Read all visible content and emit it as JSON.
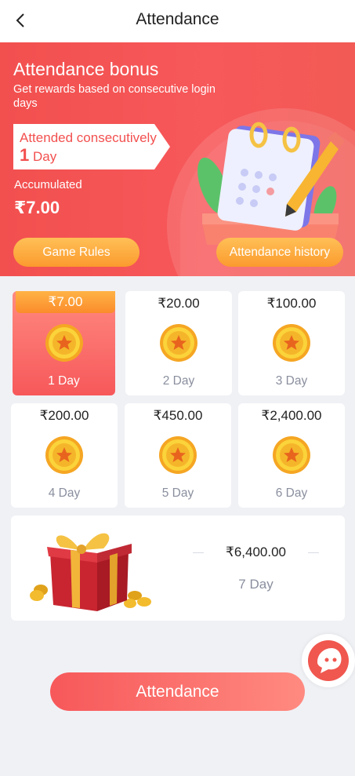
{
  "header": {
    "title": "Attendance"
  },
  "banner": {
    "title": "Attendance bonus",
    "subtitle": "Get rewards based on consecutive login days",
    "tag_prefix": "Attended consecutively",
    "tag_count": "1",
    "tag_suffix": "Day",
    "accumulated_label": "Accumulated",
    "accumulated_value": "₹7.00",
    "rules_button": "Game Rules",
    "history_button": "Attendance history"
  },
  "days": [
    {
      "amount": "₹7.00",
      "label": "1 Day",
      "active": true
    },
    {
      "amount": "₹20.00",
      "label": "2 Day",
      "active": false
    },
    {
      "amount": "₹100.00",
      "label": "3 Day",
      "active": false
    },
    {
      "amount": "₹200.00",
      "label": "4 Day",
      "active": false
    },
    {
      "amount": "₹450.00",
      "label": "5 Day",
      "active": false
    },
    {
      "amount": "₹2,400.00",
      "label": "6 Day",
      "active": false
    }
  ],
  "final_day": {
    "amount": "₹6,400.00",
    "label": "7 Day"
  },
  "attendance_button": "Attendance",
  "colors": {
    "primary": "#f7585a",
    "accent_orange": "#fb9a2e",
    "coin": "#f9c21f"
  },
  "icons": {
    "back": "chevron-left-icon",
    "coin": "star-coin-icon",
    "chat": "chat-bubble-icon"
  }
}
